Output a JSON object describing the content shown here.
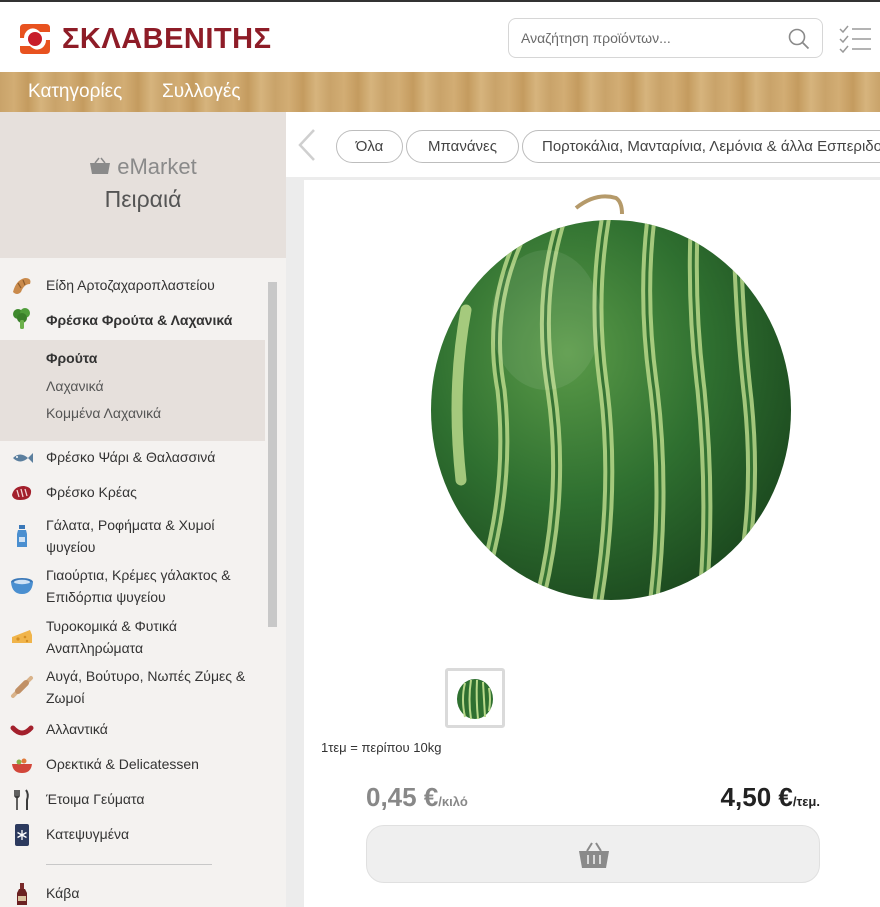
{
  "header": {
    "brand": "ΣΚΛΑΒΕΝΙΤΗΣ",
    "brand_color": "#8e1c27",
    "search_placeholder": "Αναζήτηση προϊόντων..."
  },
  "nav": {
    "categories": "Κατηγορίες",
    "collections": "Συλλογές"
  },
  "sidebar": {
    "service": "eMarket",
    "store": "Πειραιά",
    "categories": [
      {
        "label": "Είδη Αρτοζαχαροπλαστείου",
        "icon": "croissant-icon"
      },
      {
        "label": "Φρέσκα Φρούτα & Λαχανικά",
        "icon": "broccoli-icon",
        "active": true
      },
      {
        "label": "Φρέσκο Ψάρι & Θαλασσινά",
        "icon": "fish-icon"
      },
      {
        "label": "Φρέσκο Κρέας",
        "icon": "meat-icon"
      },
      {
        "label": "Γάλατα, Ροφήματα & Χυμοί ψυγείου",
        "icon": "milk-bottle-icon"
      },
      {
        "label": "Γιαούρτια, Κρέμες γάλακτος & Επιδόρπια ψυγείου",
        "icon": "yogurt-icon"
      },
      {
        "label": "Τυροκομικά & Φυτικά Αναπληρώματα",
        "icon": "cheese-icon"
      },
      {
        "label": "Αυγά, Βούτυρο, Νωπές Ζύμες & Ζωμοί",
        "icon": "rolling-pin-icon"
      },
      {
        "label": "Αλλαντικά",
        "icon": "sausage-icon"
      },
      {
        "label": "Ορεκτικά & Delicatessen",
        "icon": "bowl-icon"
      },
      {
        "label": "Έτοιμα Γεύματα",
        "icon": "cutlery-icon"
      },
      {
        "label": "Κατεψυγμένα",
        "icon": "freezer-icon"
      },
      {
        "label": "Κάβα",
        "icon": "bottle-icon"
      }
    ],
    "subcategories": [
      "Φρούτα",
      "Λαχανικά",
      "Κομμένα Λαχανικά"
    ]
  },
  "tabs": [
    "Όλα",
    "Μπανάνες",
    "Πορτοκάλια, Μανταρίνια, Λεμόνια & άλλα Εσπεριδοειδή"
  ],
  "product": {
    "weight_note": "1τεμ = περίπου 10kg",
    "price_per_kilo": "0,45 €",
    "price_per_kilo_unit": "/κιλό",
    "price_per_item": "4,50 €",
    "price_per_item_unit": "/τεμ."
  }
}
